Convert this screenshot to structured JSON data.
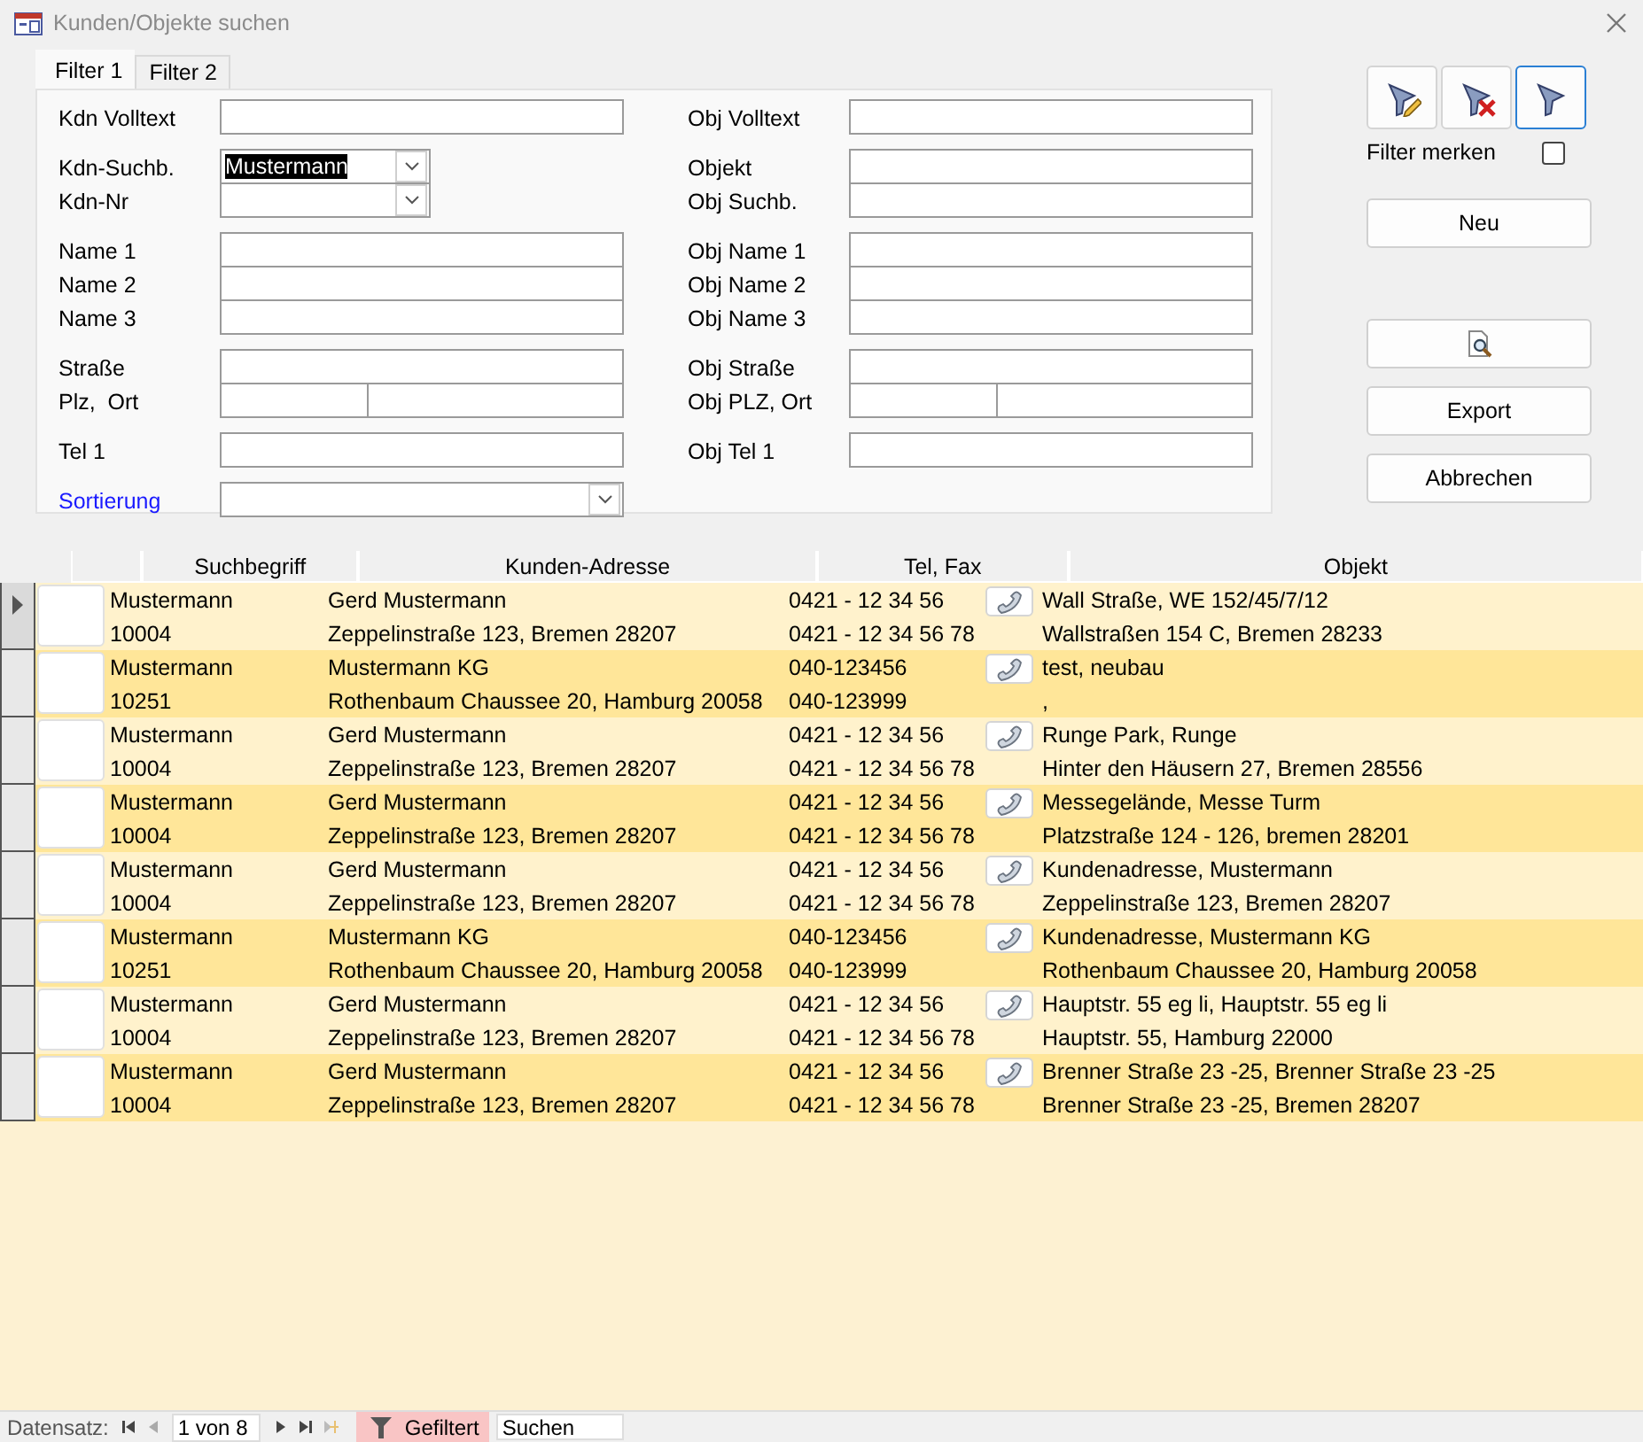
{
  "window": {
    "title": "Kunden/Objekte suchen"
  },
  "tabs": [
    {
      "label": "Filter 1",
      "selected": true
    },
    {
      "label": "Filter 2",
      "selected": false
    }
  ],
  "filter_form": {
    "left_groups": [
      [
        {
          "label": "Kdn Volltext",
          "kind": "text"
        }
      ],
      [
        {
          "label": "Kdn-Suchb.",
          "kind": "combo",
          "value": "Mustermann",
          "highlighted": true
        },
        {
          "label": "Kdn-Nr",
          "kind": "combo"
        }
      ],
      [
        {
          "label": "Name 1",
          "kind": "text"
        },
        {
          "label": "Name 2",
          "kind": "text"
        },
        {
          "label": "Name 3",
          "kind": "text"
        }
      ],
      [
        {
          "label": "Straße",
          "kind": "text"
        },
        {
          "label": "Plz,  Ort",
          "kind": "split"
        }
      ],
      [
        {
          "label": "Tel 1",
          "kind": "text"
        }
      ],
      [
        {
          "label": "Sortierung",
          "kind": "wide-combo",
          "linked": true
        }
      ]
    ],
    "right_groups": [
      [
        {
          "label": "Obj Volltext",
          "kind": "text"
        }
      ],
      [
        {
          "label": "Objekt",
          "kind": "text"
        },
        {
          "label": "Obj Suchb.",
          "kind": "text"
        }
      ],
      [
        {
          "label": "Obj Name 1",
          "kind": "text"
        },
        {
          "label": "Obj Name 2",
          "kind": "text"
        },
        {
          "label": "Obj Name 3",
          "kind": "text"
        }
      ],
      [
        {
          "label": "Obj Straße",
          "kind": "text"
        },
        {
          "label": "Obj PLZ, Ort",
          "kind": "split"
        }
      ],
      [
        {
          "label": "Obj Tel 1",
          "kind": "text"
        }
      ]
    ]
  },
  "filter_buttons": [
    {
      "kind": "edit",
      "focused": false
    },
    {
      "kind": "clear",
      "focused": false
    },
    {
      "kind": "apply",
      "focused": true
    }
  ],
  "remember_filter": {
    "label": "Filter merken",
    "checked": false
  },
  "actions": [
    {
      "kind": "text",
      "label": "Neu"
    },
    {
      "kind": "preview"
    },
    {
      "kind": "text",
      "label": "Export"
    },
    {
      "kind": "text",
      "label": "Abbrechen"
    }
  ],
  "results": {
    "columns": [
      "Suchbegriff",
      "Kunden-Adresse",
      "Tel, Fax",
      "Objekt"
    ],
    "rows": [
      {
        "selected": true,
        "search_term": "Mustermann",
        "customer_no": "10004",
        "customer_name": "Gerd Mustermann",
        "customer_address": "Zeppelinstraße 123, Bremen 28207",
        "tel": "0421 - 12 34 56",
        "fax": "0421 - 12 34 56 78",
        "object_name": "Wall Straße, WE 152/45/7/12",
        "object_address": "Wallstraßen 154 C, Bremen 28233"
      },
      {
        "selected": false,
        "search_term": "Mustermann",
        "customer_no": "10251",
        "customer_name": "Mustermann KG",
        "customer_address": "Rothenbaum Chaussee 20, Hamburg 20058",
        "tel": "040-123456",
        "fax": "040-123999",
        "object_name": "test, neubau",
        "object_address": ","
      },
      {
        "selected": false,
        "search_term": "Mustermann",
        "customer_no": "10004",
        "customer_name": "Gerd Mustermann",
        "customer_address": "Zeppelinstraße 123, Bremen 28207",
        "tel": "0421 - 12 34 56",
        "fax": "0421 - 12 34 56 78",
        "object_name": "Runge Park, Runge",
        "object_address": "Hinter den Häusern 27, Bremen 28556"
      },
      {
        "selected": false,
        "search_term": "Mustermann",
        "customer_no": "10004",
        "customer_name": "Gerd Mustermann",
        "customer_address": "Zeppelinstraße 123, Bremen 28207",
        "tel": "0421 - 12 34 56",
        "fax": "0421 - 12 34 56 78",
        "object_name": "Messegelände, Messe Turm",
        "object_address": "Platzstraße 124 - 126, bremen 28201"
      },
      {
        "selected": false,
        "search_term": "Mustermann",
        "customer_no": "10004",
        "customer_name": "Gerd Mustermann",
        "customer_address": "Zeppelinstraße 123, Bremen 28207",
        "tel": "0421 - 12 34 56",
        "fax": "0421 - 12 34 56 78",
        "object_name": "Kundenadresse, Mustermann",
        "object_address": "Zeppelinstraße 123, Bremen 28207"
      },
      {
        "selected": false,
        "search_term": "Mustermann",
        "customer_no": "10251",
        "customer_name": "Mustermann KG",
        "customer_address": "Rothenbaum Chaussee 20, Hamburg 20058",
        "tel": "040-123456",
        "fax": "040-123999",
        "object_name": "Kundenadresse, Mustermann KG",
        "object_address": "Rothenbaum Chaussee 20, Hamburg 20058"
      },
      {
        "selected": false,
        "search_term": "Mustermann",
        "customer_no": "10004",
        "customer_name": "Gerd Mustermann",
        "customer_address": "Zeppelinstraße 123, Bremen 28207",
        "tel": "0421 - 12 34 56",
        "fax": "0421 - 12 34 56 78",
        "object_name": "Hauptstr. 55 eg li, Hauptstr. 55 eg li",
        "object_address": "Hauptstr. 55, Hamburg 22000"
      },
      {
        "selected": false,
        "search_term": "Mustermann",
        "customer_no": "10004",
        "customer_name": "Gerd Mustermann",
        "customer_address": "Zeppelinstraße 123, Bremen 28207",
        "tel": "0421 - 12 34 56",
        "fax": "0421 - 12 34 56 78",
        "object_name": "Brenner Straße 23 -25, Brenner Straße 23 -25",
        "object_address": "Brenner Straße 23 -25, Bremen 28207"
      }
    ]
  },
  "status_bar": {
    "record_label": "Datensatz:",
    "position": "1 von 8",
    "filtered": true,
    "filter_label": "Gefiltert",
    "search_placeholder": "Suchen"
  }
}
